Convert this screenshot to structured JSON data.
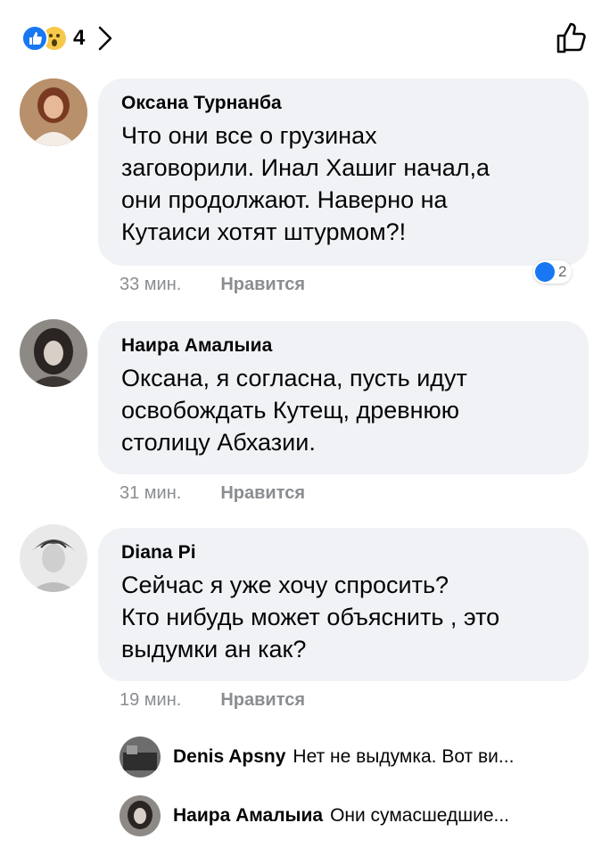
{
  "header": {
    "reaction_count": "4"
  },
  "comments": [
    {
      "author": "Оксана Турнанба",
      "text": "Что они все о грузинах\nзаговорили. Инал Хашиг начал,а\nони продолжают. Наверно на\nКутаиси хотят штурмом?!",
      "time": "33 мин.",
      "like_label": "Нравится",
      "reaction_count": "2"
    },
    {
      "author": "Наира Амалыиа",
      "text": "Оксана, я согласна, пусть идут\nосвобождать Кутещ, древнюю\nстолицу Абхазии.",
      "time": "31 мин.",
      "like_label": "Нравится"
    },
    {
      "author": "Diana Pi",
      "text": "Сейчас я уже хочу спросить?\nКто нибудь может объяснить , это\nвыдумки ан как?",
      "time": "19 мин.",
      "like_label": "Нравится"
    }
  ],
  "replies": [
    {
      "author": "Denis Apsny",
      "text": "Нет не выдумка. Вот ви..."
    },
    {
      "author": "Наира Амалыиа",
      "text": "Они сумасшедшие..."
    }
  ],
  "colors": {
    "accent": "#1877f2",
    "bubble": "#f0f2f5",
    "meta": "#8a8d91"
  }
}
